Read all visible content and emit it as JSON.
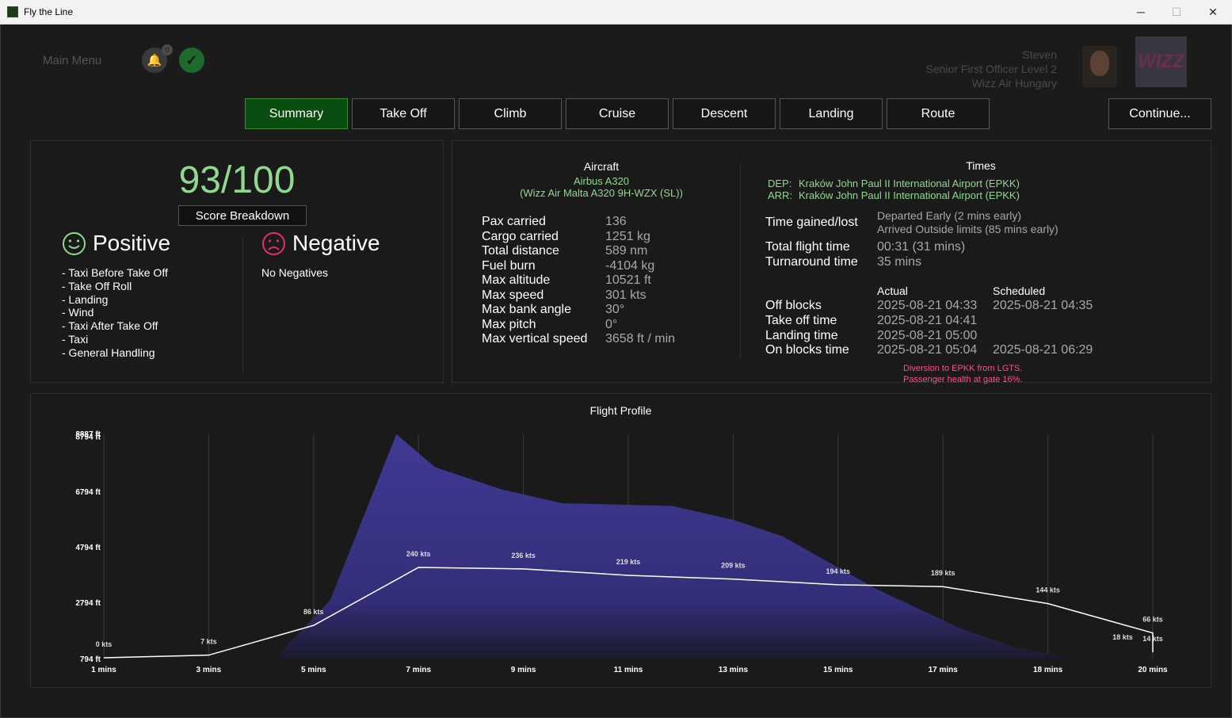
{
  "window": {
    "title": "Fly the Line",
    "minimize": "─",
    "maximize": "☐",
    "close": "✕"
  },
  "header": {
    "main_menu": "Main Menu",
    "notifications_count": "0",
    "user": {
      "name": "Steven",
      "rank": "Senior First Officer Level 2",
      "airline": "Wizz Air Hungary"
    },
    "logo_text": "WIZZ"
  },
  "tabs": [
    "Summary",
    "Take Off",
    "Climb",
    "Cruise",
    "Descent",
    "Landing",
    "Route"
  ],
  "active_tab": "Summary",
  "continue_label": "Continue...",
  "score": {
    "value": "93/100",
    "breakdown_label": "Score Breakdown",
    "positive_title": "Positive",
    "negative_title": "Negative",
    "positives": [
      "- Taxi Before Take Off",
      "- Take Off Roll",
      "- Landing",
      "- Wind",
      "- Taxi After Take Off",
      "- Taxi",
      "- General Handling"
    ],
    "negatives_text": "No Negatives"
  },
  "aircraft": {
    "heading": "Aircraft",
    "model": "Airbus A320",
    "livery": "(Wizz Air Malta A320 9H-WZX (SL))",
    "stats": [
      {
        "label": "Pax carried",
        "value": "136"
      },
      {
        "label": "Cargo carried",
        "value": "1251 kg"
      },
      {
        "label": "Total distance",
        "value": "589 nm"
      },
      {
        "label": "Fuel burn",
        "value": "-4104 kg"
      },
      {
        "label": "Max altitude",
        "value": "10521 ft"
      },
      {
        "label": "Max speed",
        "value": "301 kts"
      },
      {
        "label": "Max bank angle",
        "value": "30°"
      },
      {
        "label": "Max pitch",
        "value": "0°"
      },
      {
        "label": "Max vertical speed",
        "value": "3658 ft / min"
      }
    ]
  },
  "times": {
    "heading": "Times",
    "dep_label": "DEP:",
    "dep": "Kraków John Paul II International Airport (EPKK)",
    "arr_label": "ARR:",
    "arr": "Kraków John Paul II International Airport (EPKK)",
    "gained_label": "Time gained/lost",
    "gained_1": "Departed Early (2 mins early)",
    "gained_2": "Arrived Outside limits (85 mins early)",
    "total_label": "Total flight time",
    "total": "00:31 (31 mins)",
    "turnaround_label": "Turnaround time",
    "turnaround": "35 mins",
    "actual_head": "Actual",
    "scheduled_head": "Scheduled",
    "rows": [
      {
        "label": "Off blocks",
        "actual": "2025-08-21 04:33",
        "scheduled": "2025-08-21 04:35"
      },
      {
        "label": "Take off time",
        "actual": "2025-08-21 04:41",
        "scheduled": ""
      },
      {
        "label": "Landing time",
        "actual": "2025-08-21 05:00",
        "scheduled": ""
      },
      {
        "label": "On blocks time",
        "actual": "2025-08-21 05:04",
        "scheduled": "2025-08-21 06:29"
      }
    ],
    "note_1": "Diversion to EPKK from LGTS.",
    "note_2": "Passenger health at gate 16%."
  },
  "chart_data": {
    "type": "area",
    "title": "Flight Profile",
    "x_ticks": [
      "1 mins",
      "3 mins",
      "5 mins",
      "7 mins",
      "9 mins",
      "11 mins",
      "13 mins",
      "15 mins",
      "17 mins",
      "18 mins",
      "20 mins"
    ],
    "y_ticks": [
      "794 ft",
      "2794 ft",
      "4794 ft",
      "6794 ft",
      "8794 ft",
      "8887 ft"
    ],
    "altitude_series": {
      "x_minutes": [
        4.1,
        5.1,
        6.3,
        7.0,
        8.2,
        9.3,
        11.3,
        12.4,
        13.3,
        15.0,
        16.5,
        17.5,
        18.5
      ],
      "y_ft": [
        794,
        2900,
        8887,
        7700,
        6900,
        6400,
        6300,
        5800,
        5200,
        3300,
        1900,
        1200,
        794
      ]
    },
    "speed_series": {
      "x_minutes": [
        1,
        3,
        5,
        7,
        9,
        11,
        13,
        15,
        17,
        18,
        20
      ],
      "kts": [
        0,
        7,
        86,
        240,
        236,
        219,
        209,
        194,
        189,
        144,
        66
      ],
      "labels": [
        "0 kts",
        "7 kts",
        "86 kts",
        "240 kts",
        "236 kts",
        "219 kts",
        "209 kts",
        "194 kts",
        "189 kts",
        "144 kts",
        "66 kts",
        "18 kts",
        "14 kts"
      ]
    }
  }
}
